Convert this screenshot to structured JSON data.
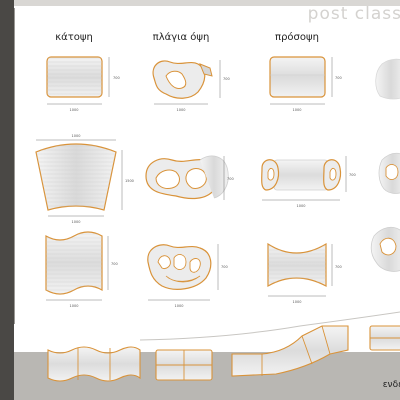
{
  "brand": "post class",
  "columns": [
    "κάτοψη",
    "πλάγια όψη",
    "πρόσοψη"
  ],
  "legend": "ενδει",
  "dims": {
    "row1": {
      "plan_w": "1000",
      "plan_h": "700",
      "side_w": "1000",
      "side_h": "700",
      "front_w": "1000",
      "front_h": "700"
    },
    "row2": {
      "plan_w1": "1000",
      "plan_w2": "1000",
      "plan_h": "1500",
      "side_h": "700",
      "front_w": "1000",
      "front_h": "700"
    },
    "row3": {
      "plan_w": "1000",
      "plan_h": "700",
      "side_w": "1000",
      "side_h": "700",
      "front_w": "1000",
      "front_h": "700"
    }
  },
  "colors": {
    "outline": "#d9933a",
    "shade": "#d8d8d8",
    "dim": "#555555",
    "sidebar": "#4a4845"
  }
}
